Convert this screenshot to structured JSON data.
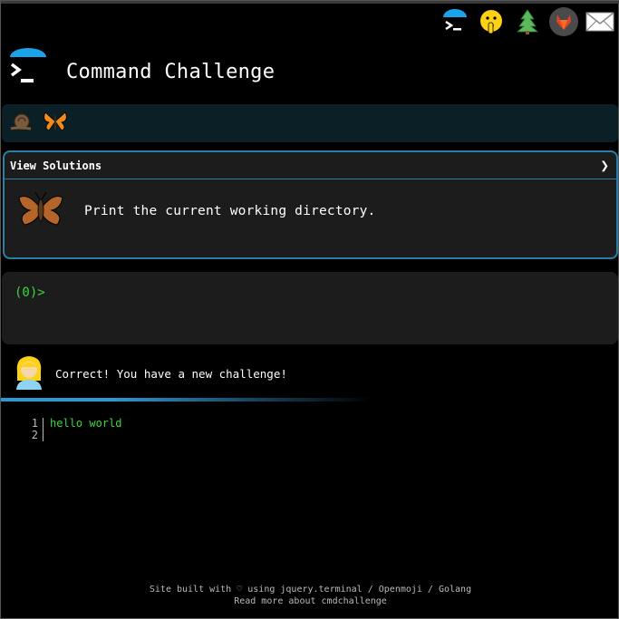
{
  "header": {
    "title": "Command Challenge",
    "icons": [
      "terminal-logo-icon",
      "shushing-face-icon",
      "tree-icon",
      "gitlab-icon",
      "mail-icon"
    ]
  },
  "badges": [
    "snail-icon",
    "butterfly-icon"
  ],
  "challenge": {
    "view_solutions": "View Solutions",
    "chevron": "❯",
    "description": "Print the current working directory."
  },
  "terminal": {
    "prompt": "(0)>"
  },
  "status": {
    "message": "Correct! You have a new challenge!"
  },
  "editor": {
    "lines": [
      {
        "number": "1",
        "text": "hello world"
      },
      {
        "number": "2",
        "text": ""
      }
    ]
  },
  "footer": {
    "line1": "Site built with ♡ using jquery.terminal / Openmoji / Golang",
    "line2": "Read more about cmdchallenge"
  },
  "colors": {
    "accent": "#2a9ad6",
    "prompt_green": "#3ad83a",
    "panel_bg": "#1c1c1c",
    "badge_bar_bg": "#0b1f26"
  }
}
